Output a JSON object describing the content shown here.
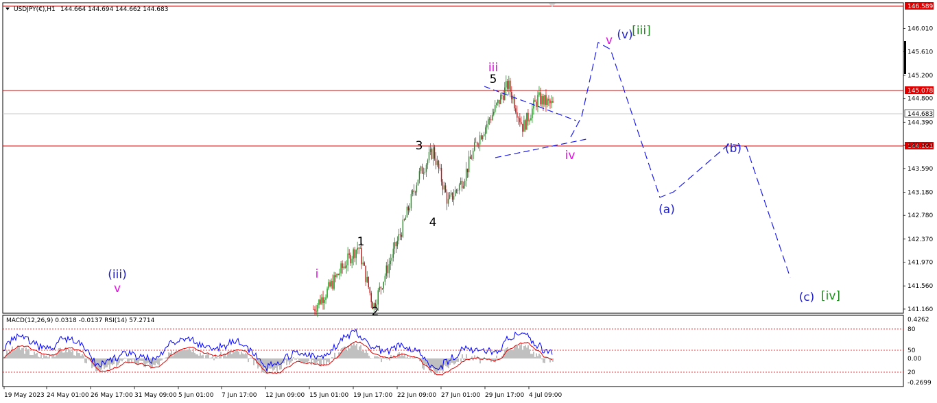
{
  "header": {
    "symbol_info": "USDJPY(€),H1",
    "ohlc": "144.664 144.694 144.662 144.683",
    "indicator_info": "MACD(12,26,9) 0.0318 -0.0137  RSI(14) 57.2714"
  },
  "colors": {
    "bull": "#00a000",
    "bear": "#e00000",
    "level_line": "#e00000",
    "price_tag": "#e00000",
    "magenta": "#e010e0",
    "blue_label": "#2020d0",
    "green_label": "#1f8a1f",
    "projection": "#1a1aee",
    "macd_hist": "#c0c0c0",
    "rsi": "#0000ff",
    "signal": "#e00000"
  },
  "chart_data": {
    "type": "candlestick",
    "symbol": "USDJPY",
    "timeframe": "H1",
    "y_range": [
      141.16,
      146.589
    ],
    "levels": [
      146.589,
      145.078,
      144.101
    ],
    "current_price": 144.683,
    "price_ticks": [
      "146.589",
      "146.010",
      "145.610",
      "145.200",
      "145.078",
      "144.800",
      "144.683",
      "144.390",
      "144.101",
      "143.990",
      "143.590",
      "143.180",
      "142.780",
      "142.370",
      "141.970",
      "141.560",
      "141.160"
    ],
    "time_ticks": [
      "19 May 2023",
      "24 May 01:00",
      "26 May 17:00",
      "31 May 09:00",
      "5 Jun 01:00",
      "7 Jun 17:00",
      "12 Jun 09:00",
      "15 Jun 01:00",
      "19 Jun 17:00",
      "22 Jun 09:00",
      "27 Jun 01:00",
      "29 Jun 17:00",
      "4 Jul 09:00"
    ],
    "price_path": [
      {
        "t": "15 Jun 01:00",
        "p": 141.16
      },
      {
        "t": "15 Jun",
        "p": 141.5
      },
      {
        "t": "16 Jun",
        "p": 141.9
      },
      {
        "t": "19 Jun",
        "p": 142.25
      },
      {
        "t": "20 Jun",
        "p": 141.2
      },
      {
        "t": "21 Jun",
        "p": 141.9
      },
      {
        "t": "22 Jun",
        "p": 142.6
      },
      {
        "t": "23 Jun",
        "p": 143.45
      },
      {
        "t": "26 Jun",
        "p": 143.9
      },
      {
        "t": "26 Jun",
        "p": 143.0
      },
      {
        "t": "27 Jun",
        "p": 143.4
      },
      {
        "t": "28 Jun",
        "p": 144.1
      },
      {
        "t": "29 Jun",
        "p": 144.55
      },
      {
        "t": "29 Jun 17:00",
        "p": 145.05
      },
      {
        "t": "30 Jun",
        "p": 144.3
      },
      {
        "t": "3 Jul",
        "p": 144.8
      },
      {
        "t": "4 Jul 09:00",
        "p": 144.683
      }
    ],
    "projection": [
      {
        "label": "iv",
        "p": 144.2
      },
      {
        "label": "v",
        "p": 146.0
      },
      {
        "label": "(a)",
        "p": 143.2
      },
      {
        "label": "(b)",
        "p": 144.1
      },
      {
        "label": "(c)",
        "p": 141.7
      }
    ],
    "wave_labels": [
      "(iii)",
      "v",
      "i",
      "1",
      "2",
      "3",
      "4",
      "5",
      "iii",
      "iv",
      "v",
      "(v)",
      "[iii]",
      "(a)",
      "(b)",
      "(c)",
      "[iv]"
    ],
    "indicator": {
      "type": "MACD+RSI",
      "macd_params": "12,26,9",
      "rsi_period": 14,
      "macd": 0.0318,
      "signal": -0.0137,
      "rsi": 57.2714,
      "right_ticks": [
        "0.4262",
        "80",
        "50",
        "0.00",
        "20",
        "-0.2699"
      ]
    }
  },
  "waves": {
    "iii_paren": "(iii)",
    "v_small": "v",
    "i_small": "i",
    "w1": "1",
    "w2": "2",
    "w3": "3",
    "w4": "4",
    "w5": "5",
    "iii_small": "iii",
    "iv_small": "iv",
    "v_top": "v",
    "v_paren": "(v)",
    "iii_bracket": "[iii]",
    "a_paren": "(a)",
    "b_paren": "(b)",
    "c_paren": "(c)",
    "iv_bracket": "[iv]"
  }
}
